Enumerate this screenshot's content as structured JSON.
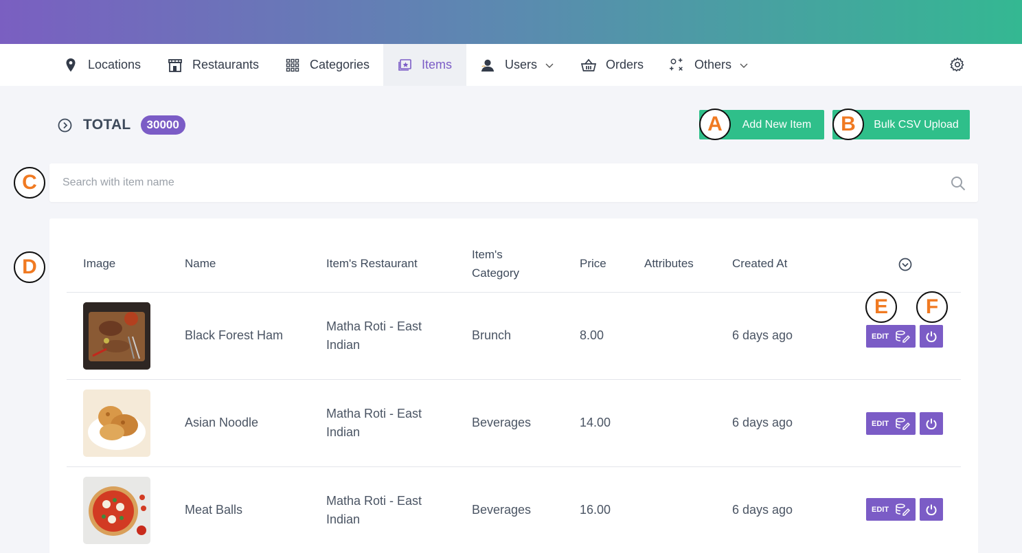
{
  "nav": {
    "items": [
      {
        "label": "Locations",
        "icon": "map-pin-icon"
      },
      {
        "label": "Restaurants",
        "icon": "store-icon"
      },
      {
        "label": "Categories",
        "icon": "grid-icon"
      },
      {
        "label": "Items",
        "icon": "items-icon",
        "active": true
      },
      {
        "label": "Users",
        "icon": "user-icon",
        "dropdown": true
      },
      {
        "label": "Orders",
        "icon": "basket-icon"
      },
      {
        "label": "Others",
        "icon": "others-icon",
        "dropdown": true
      }
    ],
    "settings_icon": "gear-icon"
  },
  "summary": {
    "total_label": "TOTAL",
    "total_count": "30000"
  },
  "actions": {
    "add_label": "Add New Item",
    "bulk_label": "Bulk CSV Upload"
  },
  "search": {
    "placeholder": "Search with item name",
    "value": ""
  },
  "table": {
    "headers": {
      "image": "Image",
      "name": "Name",
      "restaurant": "Item's Restaurant",
      "category_l1": "Item's",
      "category_l2": "Category",
      "price": "Price",
      "attributes": "Attributes",
      "created": "Created At"
    },
    "rows": [
      {
        "name": "Black Forest Ham",
        "restaurant_l1": "Matha Roti - East",
        "restaurant_l2": "Indian",
        "category": "Brunch",
        "price": "8.00",
        "attributes": "",
        "created": "6 days ago",
        "edit_label": "EDIT"
      },
      {
        "name": "Asian Noodle",
        "restaurant_l1": "Matha Roti - East",
        "restaurant_l2": "Indian",
        "category": "Beverages",
        "price": "14.00",
        "attributes": "",
        "created": "6 days ago",
        "edit_label": "EDIT"
      },
      {
        "name": "Meat Balls",
        "restaurant_l1": "Matha Roti - East",
        "restaurant_l2": "Indian",
        "category": "Beverages",
        "price": "16.00",
        "attributes": "",
        "created": "6 days ago",
        "edit_label": "EDIT"
      }
    ]
  },
  "markers": {
    "a": "A",
    "b": "B",
    "c": "C",
    "d": "D",
    "e": "E",
    "f": "F"
  },
  "colors": {
    "accent": "#7b5cc6",
    "green": "#2fbf8a",
    "marker_text": "#f07a22"
  }
}
